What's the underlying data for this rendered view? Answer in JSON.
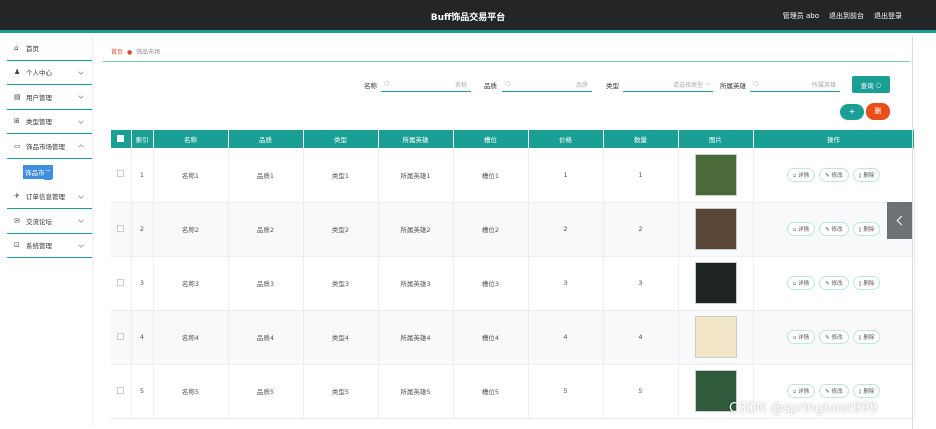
{
  "app": {
    "title": "Buff饰品交易平台"
  },
  "top_links": [
    "管理员 abo",
    "退出到前台",
    "退出登录"
  ],
  "sidebar": {
    "items": [
      {
        "label": "首页",
        "icon": "home-icon",
        "chevron": false
      },
      {
        "label": "个人中心",
        "icon": "user-icon",
        "chevron": true
      },
      {
        "label": "用户管理",
        "icon": "user-manage-icon",
        "chevron": true
      },
      {
        "label": "类型管理",
        "icon": "grid-icon",
        "chevron": true
      },
      {
        "label": "饰品市场管理",
        "icon": "market-icon",
        "chevron": true,
        "expanded": true
      }
    ],
    "active_sub": "饰品市场",
    "items_after": [
      {
        "label": "订单信息管理",
        "icon": "send-icon"
      },
      {
        "label": "交流论坛",
        "icon": "mail-icon"
      },
      {
        "label": "系统管理",
        "icon": "system-icon"
      }
    ]
  },
  "breadcrumb": {
    "home": "首页",
    "current": "饰品市场"
  },
  "filters": [
    {
      "label": "名称",
      "placeholder": "名称"
    },
    {
      "label": "品质",
      "placeholder": "品质"
    },
    {
      "label": "类型",
      "placeholder": "请选择类型"
    },
    {
      "label": "所属英雄",
      "placeholder": "所属英雄"
    }
  ],
  "search_label": "查询",
  "add_label": "+",
  "delete_label": "删",
  "table": {
    "headers": [
      "索引",
      "名称",
      "品质",
      "类型",
      "所属英雄",
      "槽位",
      "价格",
      "数量",
      "图片",
      "操作"
    ],
    "rows": [
      {
        "idx": "1",
        "name": "名称1",
        "quality": "品质1",
        "type": "类型1",
        "hero": "所属英雄1",
        "slot": "槽位1",
        "price": "1",
        "qty": "1",
        "img": "#4b6a3a"
      },
      {
        "idx": "2",
        "name": "名称2",
        "quality": "品质2",
        "type": "类型2",
        "hero": "所属英雄2",
        "slot": "槽位2",
        "price": "2",
        "qty": "2",
        "img": "#5a4634"
      },
      {
        "idx": "3",
        "name": "名称3",
        "quality": "品质3",
        "type": "类型3",
        "hero": "所属英雄3",
        "slot": "槽位3",
        "price": "3",
        "qty": "3",
        "img": "#1e2324"
      },
      {
        "idx": "4",
        "name": "名称4",
        "quality": "品质4",
        "type": "类型4",
        "hero": "所属英雄4",
        "slot": "槽位4",
        "price": "4",
        "qty": "4",
        "img": "#f2e6c8"
      },
      {
        "idx": "5",
        "name": "名称5",
        "quality": "品质5",
        "type": "类型5",
        "hero": "所属英雄5",
        "slot": "槽位5",
        "price": "5",
        "qty": "5",
        "img": "#2f5a3c"
      }
    ],
    "ops": [
      "详情",
      "修改",
      "删除"
    ]
  },
  "watermark": "CSDN @springboot999",
  "colors": {
    "accent": "#1a9f95",
    "danger": "#e94e1b",
    "header_bg": "#232526"
  }
}
